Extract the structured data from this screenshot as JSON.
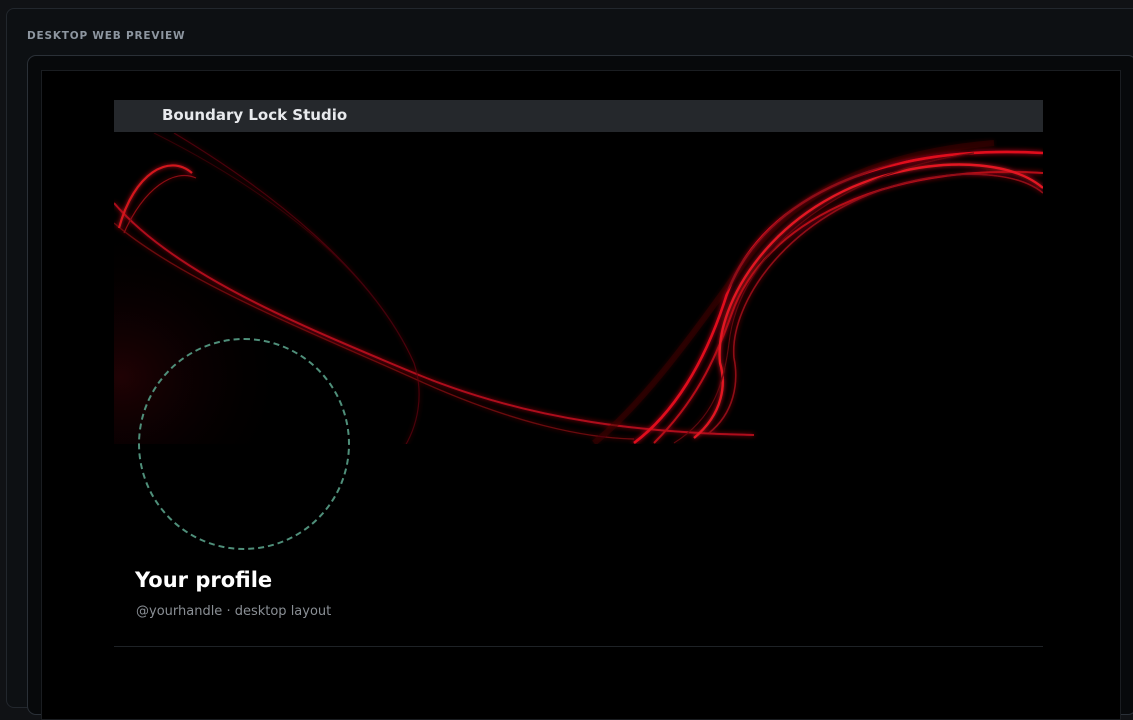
{
  "panel": {
    "title": "DESKTOP WEB PREVIEW"
  },
  "site": {
    "title": "Boundary Lock Studio"
  },
  "profile": {
    "name": "Your profile",
    "subtitle": "@yourhandle · desktop layout"
  },
  "colors": {
    "page_background": "#101215",
    "header_bar": "#25282c",
    "banner_background": "#000000",
    "banner_accent": "#e0101e",
    "avatar_dashed_ring": "#4f8f7a",
    "profile_name": "#ffffff",
    "profile_subtitle": "#8a8f95"
  }
}
